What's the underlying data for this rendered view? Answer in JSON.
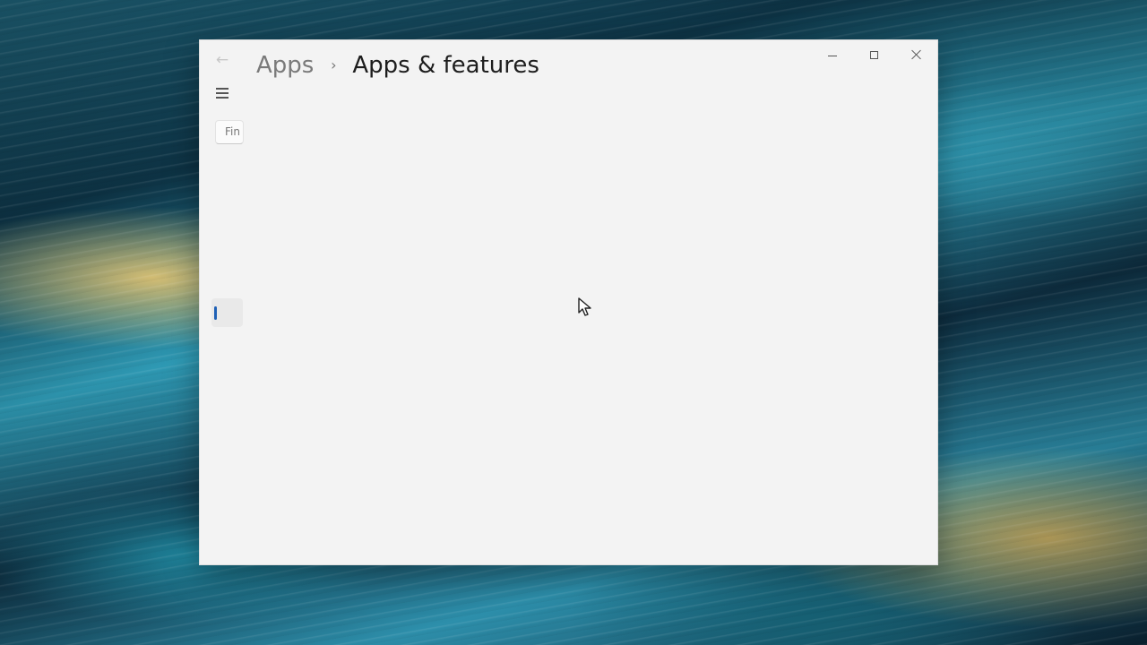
{
  "window": {
    "breadcrumb_parent": "Apps",
    "breadcrumb_separator": "›",
    "page_title": "Apps & features",
    "back_icon": "arrow-left-icon",
    "menu_icon": "hamburger-menu-icon"
  },
  "search": {
    "placeholder": "Fin"
  },
  "window_controls": {
    "minimize_icon": "minimize-icon",
    "maximize_icon": "maximize-icon",
    "close_icon": "close-icon"
  },
  "colors": {
    "window_background": "#f3f3f3",
    "accent": "#1f61b6"
  }
}
